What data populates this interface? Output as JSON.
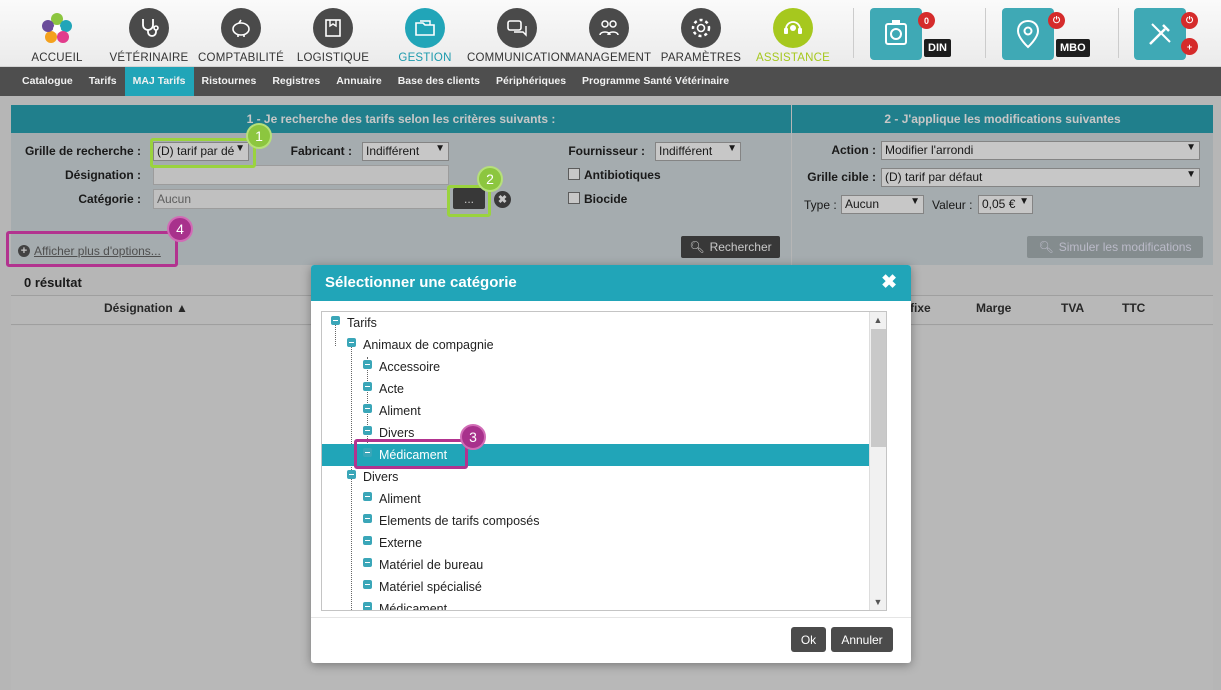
{
  "nav": {
    "items": [
      {
        "label": "ACCUEIL",
        "icon": "flower-logo-icon"
      },
      {
        "label": "VÉTÉRINAIRE",
        "icon": "stethoscope-icon"
      },
      {
        "label": "COMPTABILITÉ",
        "icon": "piggy-bank-icon"
      },
      {
        "label": "LOGISTIQUE",
        "icon": "box-icon"
      },
      {
        "label": "GESTION",
        "icon": "folder-icon"
      },
      {
        "label": "COMMUNICATION",
        "icon": "chat-icon"
      },
      {
        "label": "MANAGEMENT",
        "icon": "team-icon"
      },
      {
        "label": "PARAMÈTRES",
        "icon": "gear-icon"
      },
      {
        "label": "ASSISTANCE",
        "icon": "support-icon"
      }
    ],
    "active": "GESTION",
    "users": [
      {
        "tag": "DIN",
        "badge": "0"
      },
      {
        "tag": "MBO",
        "badge": ""
      }
    ]
  },
  "subnav": {
    "items": [
      "Catalogue",
      "Tarifs",
      "MAJ Tarifs",
      "Ristournes",
      "Registres",
      "Annuaire",
      "Base des clients",
      "Périphériques",
      "Programme Santé Vétérinaire"
    ],
    "active": "MAJ Tarifs"
  },
  "search": {
    "title": "1 - Je recherche des tarifs selon les critères suivants :",
    "grille_label": "Grille de recherche :",
    "grille_value": "(D) tarif par dé",
    "fabricant_label": "Fabricant :",
    "fabricant_value": "Indifférent",
    "fournisseur_label": "Fournisseur :",
    "fournisseur_value": "Indifférent",
    "designation_label": "Désignation :",
    "designation_value": "",
    "categorie_label": "Catégorie :",
    "categorie_value": "Aucun",
    "browse_label": "...",
    "antibiotiques_label": "Antibiotiques",
    "biocide_label": "Biocide",
    "more_options_label": "Afficher plus d'options...",
    "search_button": "Rechercher"
  },
  "modify": {
    "title": "2 - J'applique les modifications suivantes",
    "action_label": "Action :",
    "action_value": "Modifier l'arrondi",
    "grille_cible_label": "Grille cible :",
    "grille_cible_value": "(D) tarif par défaut",
    "type_label": "Type :",
    "type_value": "Aucun",
    "valeur_label": "Valeur :",
    "valeur_value": "0,05 €",
    "simulate_button": "Simuler les modifications"
  },
  "results": {
    "count_label": "0 résultat",
    "columns": [
      "Désignation",
      "fixe",
      "Marge",
      "TVA",
      "TTC"
    ]
  },
  "dialog": {
    "title": "Sélectionner une catégorie",
    "tree": [
      {
        "label": "Tarifs",
        "level": 0
      },
      {
        "label": "Animaux de compagnie",
        "level": 1
      },
      {
        "label": "Accessoire",
        "level": 2
      },
      {
        "label": "Acte",
        "level": 2
      },
      {
        "label": "Aliment",
        "level": 2
      },
      {
        "label": "Divers",
        "level": 2
      },
      {
        "label": "Médicament",
        "level": 2,
        "selected": true
      },
      {
        "label": "Divers",
        "level": 1
      },
      {
        "label": "Aliment",
        "level": 2
      },
      {
        "label": "Elements de tarifs composés",
        "level": 2
      },
      {
        "label": "Externe",
        "level": 2
      },
      {
        "label": "Matériel de bureau",
        "level": 2
      },
      {
        "label": "Matériel spécialisé",
        "level": 2
      },
      {
        "label": "Médicament",
        "level": 2
      }
    ],
    "ok_button": "Ok",
    "cancel_button": "Annuler"
  },
  "annotations": [
    "1",
    "2",
    "3",
    "4"
  ],
  "colors": {
    "accent": "#21a5b8",
    "highlight_green": "#9ad33e",
    "highlight_purple": "#b2338f",
    "assist": "#a6c81e"
  }
}
